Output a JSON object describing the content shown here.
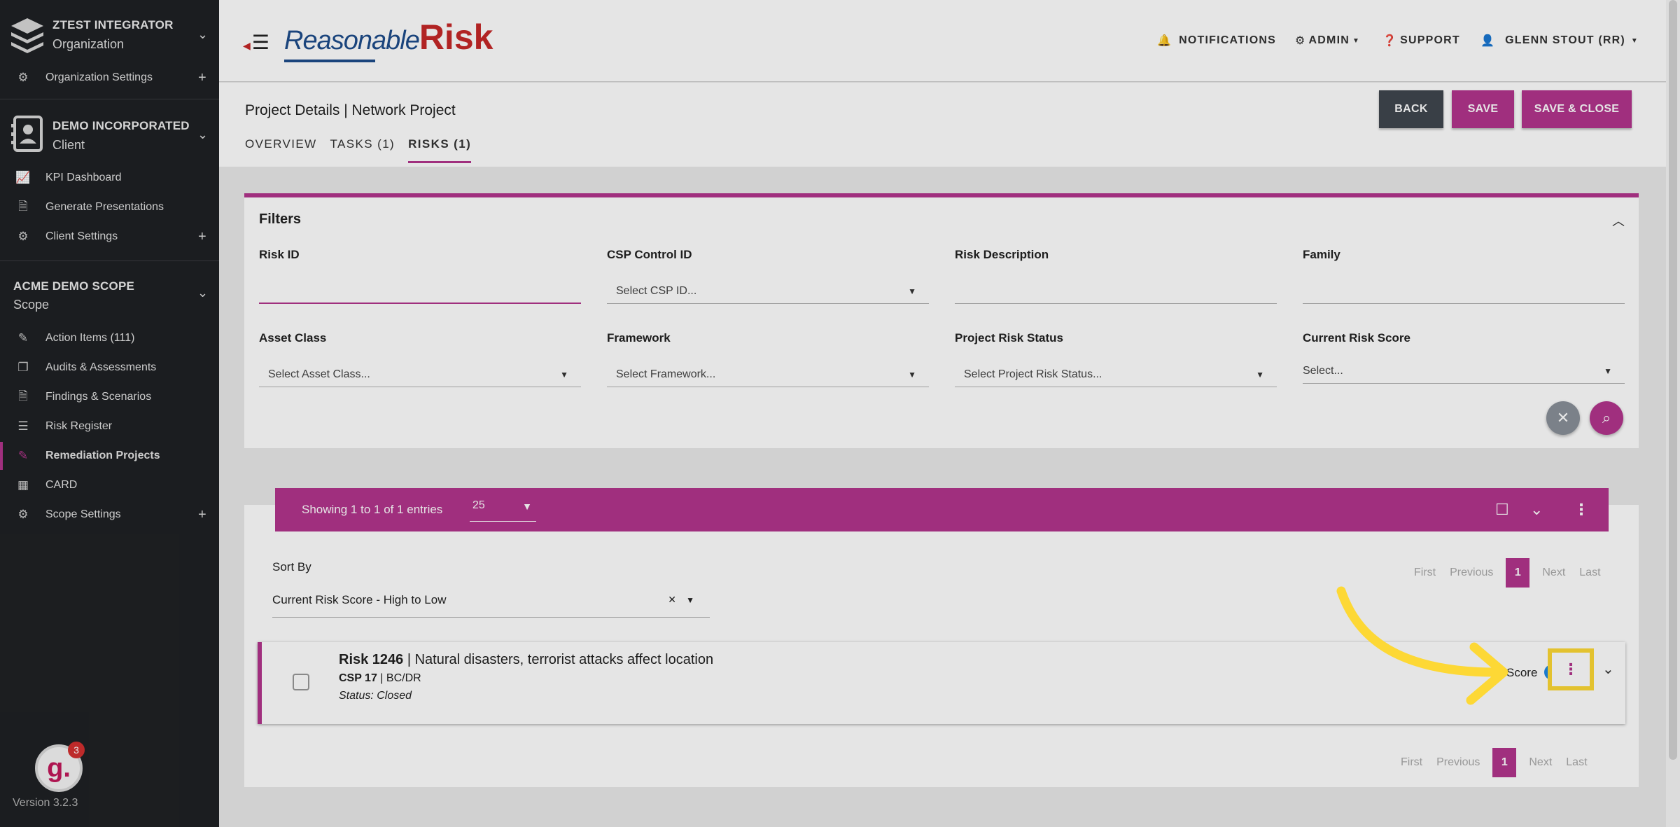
{
  "sidebar": {
    "org": {
      "name": "ZTEST INTEGRATOR",
      "type": "Organization"
    },
    "org_items": [
      {
        "label": "Organization Settings",
        "icon": "gear-icon",
        "plus": true
      }
    ],
    "client": {
      "name": "DEMO INCORPORATED",
      "type": "Client"
    },
    "client_items": [
      {
        "label": "KPI Dashboard",
        "icon": "chart-icon"
      },
      {
        "label": "Generate Presentations",
        "icon": "document-icon"
      },
      {
        "label": "Client Settings",
        "icon": "gear-icon",
        "plus": true
      }
    ],
    "scope": {
      "name": "ACME DEMO SCOPE",
      "type": "Scope"
    },
    "scope_items": [
      {
        "label": "Action Items (111)",
        "icon": "edit-icon"
      },
      {
        "label": "Audits & Assessments",
        "icon": "copy-icon"
      },
      {
        "label": "Findings & Scenarios",
        "icon": "document-icon"
      },
      {
        "label": "Risk Register",
        "icon": "list-icon"
      },
      {
        "label": "Remediation Projects",
        "icon": "edit-icon",
        "active": true
      },
      {
        "label": "CARD",
        "icon": "grid-icon"
      },
      {
        "label": "Scope Settings",
        "icon": "gear-icon",
        "plus": true
      }
    ],
    "badge_letter": "g.",
    "badge_count": "3",
    "version": "Version 3.2.3"
  },
  "topbar": {
    "logo_reasonable": "Reasonable",
    "logo_risk": "Risk",
    "notifications": "NOTIFICATIONS",
    "admin": "ADMIN",
    "support": "SUPPORT",
    "user": "GLENN STOUT (RR)"
  },
  "page": {
    "title": "Project Details | Network Project",
    "tabs": [
      {
        "label": "OVERVIEW"
      },
      {
        "label": "TASKS (1)"
      },
      {
        "label": "RISKS (1)",
        "active": true
      }
    ],
    "buttons": {
      "back": "BACK",
      "save": "SAVE",
      "save_close": "SAVE & CLOSE"
    }
  },
  "filters": {
    "heading": "Filters",
    "risk_id": {
      "label": "Risk ID",
      "value": ""
    },
    "csp_control_id": {
      "label": "CSP Control ID",
      "placeholder": "Select CSP ID..."
    },
    "risk_description": {
      "label": "Risk Description",
      "value": ""
    },
    "family": {
      "label": "Family",
      "value": ""
    },
    "asset_class": {
      "label": "Asset Class",
      "placeholder": "Select Asset Class..."
    },
    "framework": {
      "label": "Framework",
      "placeholder": "Select Framework..."
    },
    "project_risk_status": {
      "label": "Project Risk Status",
      "placeholder": "Select Project Risk Status..."
    },
    "current_risk_score": {
      "label": "Current Risk Score",
      "placeholder": "Select..."
    }
  },
  "results": {
    "showing": "Showing 1 to 1 of 1 entries",
    "page_size": "25",
    "sort_label": "Sort By",
    "sort_value": "Current Risk Score - High to Low",
    "pager": {
      "first": "First",
      "previous": "Previous",
      "current": "1",
      "next": "Next",
      "last": "Last"
    },
    "risk": {
      "id": "Risk 1246",
      "description": "Natural disasters, terrorist attacks affect location",
      "csp": "CSP 17",
      "family": "BC/DR",
      "status": "Status: Closed",
      "score_label": "Score"
    }
  },
  "colors": {
    "accent": "#b3358d",
    "sidebar": "#1f2124",
    "highlight": "#fdd835",
    "logo_blue": "#1e4c8b",
    "logo_red": "#c62828"
  }
}
